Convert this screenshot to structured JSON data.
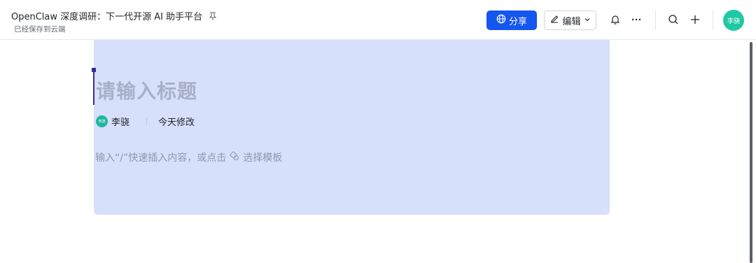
{
  "header": {
    "title": "OpenClaw 深度调研：下一代开源 AI 助手平台",
    "saved_status": "已经保存到云端",
    "share_label": "分享",
    "edit_label": "编辑",
    "avatar_text": "李骁",
    "icons": [
      "pin-icon",
      "globe-icon",
      "pencil-icon",
      "chevron-down-icon",
      "bell-icon",
      "more-icon",
      "search-icon",
      "plus-icon"
    ]
  },
  "editor": {
    "title_placeholder": "请输入标题",
    "author": "李骁",
    "author_avatar_text": "李骁",
    "modified": "今天修改",
    "body_placeholder_prefix": "输入“/”快速插入内容，或点击",
    "template_label": "选择模板"
  },
  "colors": {
    "primary": "#1456f0",
    "selection": "#d6e0fb",
    "avatar": "#1fc8a5"
  }
}
